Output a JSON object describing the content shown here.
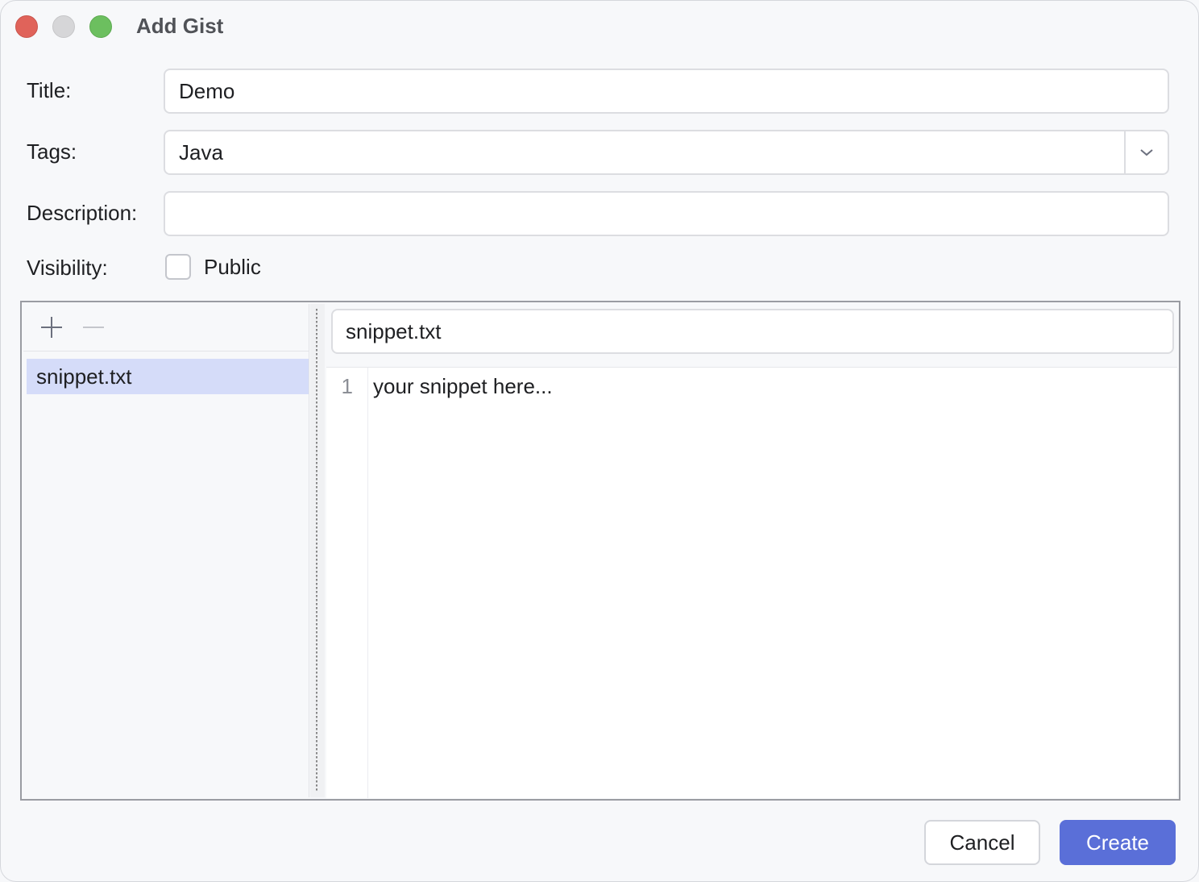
{
  "window": {
    "title": "Add Gist"
  },
  "form": {
    "title_label": "Title:",
    "title_value": "Demo",
    "tags_label": "Tags:",
    "tags_value": "Java",
    "description_label": "Description:",
    "description_value": "",
    "visibility_label": "Visibility:",
    "public_label": "Public",
    "public_checked": false
  },
  "files": {
    "items": [
      {
        "name": "snippet.txt",
        "selected": true
      }
    ],
    "current_filename": "snippet.txt"
  },
  "editor": {
    "lines": [
      {
        "number": "1",
        "text": "your snippet here..."
      }
    ]
  },
  "buttons": {
    "cancel_label": "Cancel",
    "create_label": "Create"
  },
  "colors": {
    "accent": "#5a6fd8",
    "selection": "#d5dcf9"
  },
  "icons": {
    "add": "plus-icon",
    "remove": "minus-icon",
    "dropdown": "chevron-down-icon"
  }
}
